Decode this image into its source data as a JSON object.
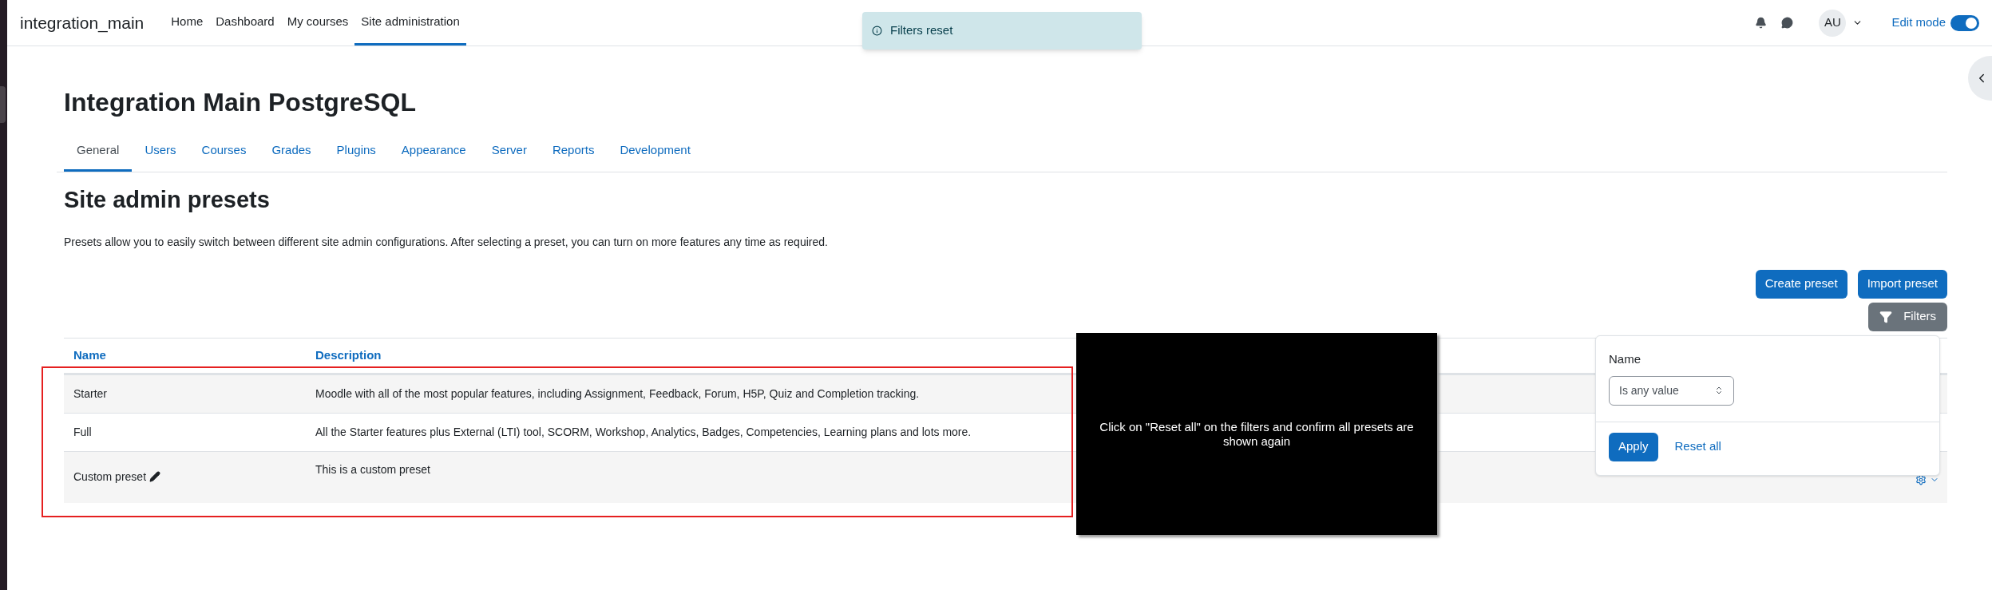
{
  "navbar": {
    "site_name": "integration_main",
    "items": [
      {
        "label": "Home",
        "selected": false
      },
      {
        "label": "Dashboard",
        "selected": false
      },
      {
        "label": "My courses",
        "selected": false
      },
      {
        "label": "Site administration",
        "selected": true
      }
    ],
    "avatar": "AU",
    "edit_mode": {
      "label": "Edit mode",
      "on": true
    }
  },
  "toast": {
    "text": "Filters reset"
  },
  "page_title": "Integration Main PostgreSQL",
  "tabs": [
    {
      "label": "General",
      "selected": true
    },
    {
      "label": "Users",
      "selected": false
    },
    {
      "label": "Courses",
      "selected": false
    },
    {
      "label": "Grades",
      "selected": false
    },
    {
      "label": "Plugins",
      "selected": false
    },
    {
      "label": "Appearance",
      "selected": false
    },
    {
      "label": "Server",
      "selected": false
    },
    {
      "label": "Reports",
      "selected": false
    },
    {
      "label": "Development",
      "selected": false
    }
  ],
  "heading": "Site admin presets",
  "intro": "Presets allow you to easily switch between different site admin configurations. After selecting a preset, you can turn on more features any time as required.",
  "buttons": [
    "Create preset",
    "Import preset"
  ],
  "filters_button": "Filters",
  "filter_panel": {
    "label": "Name",
    "select_value": "Is any value",
    "apply": "Apply",
    "reset": "Reset all"
  },
  "table": {
    "columns": [
      "Name",
      "Description"
    ],
    "rows": [
      {
        "name": "Starter",
        "description": "Moodle with all of the most popular features, including Assignment, Feedback, Forum, H5P, Quiz and Completion tracking.",
        "editable": false,
        "actions": false
      },
      {
        "name": "Full",
        "description": "All the Starter features plus External (LTI) tool, SCORM, Workshop, Analytics, Badges, Competencies, Learning plans and lots more.",
        "editable": false,
        "actions": false
      },
      {
        "name": "Custom preset",
        "description": "This is a custom preset",
        "editable": true,
        "actions": true
      }
    ]
  },
  "overlay_note": "Click on \"Reset all\" on the filters and confirm all presets are shown again"
}
